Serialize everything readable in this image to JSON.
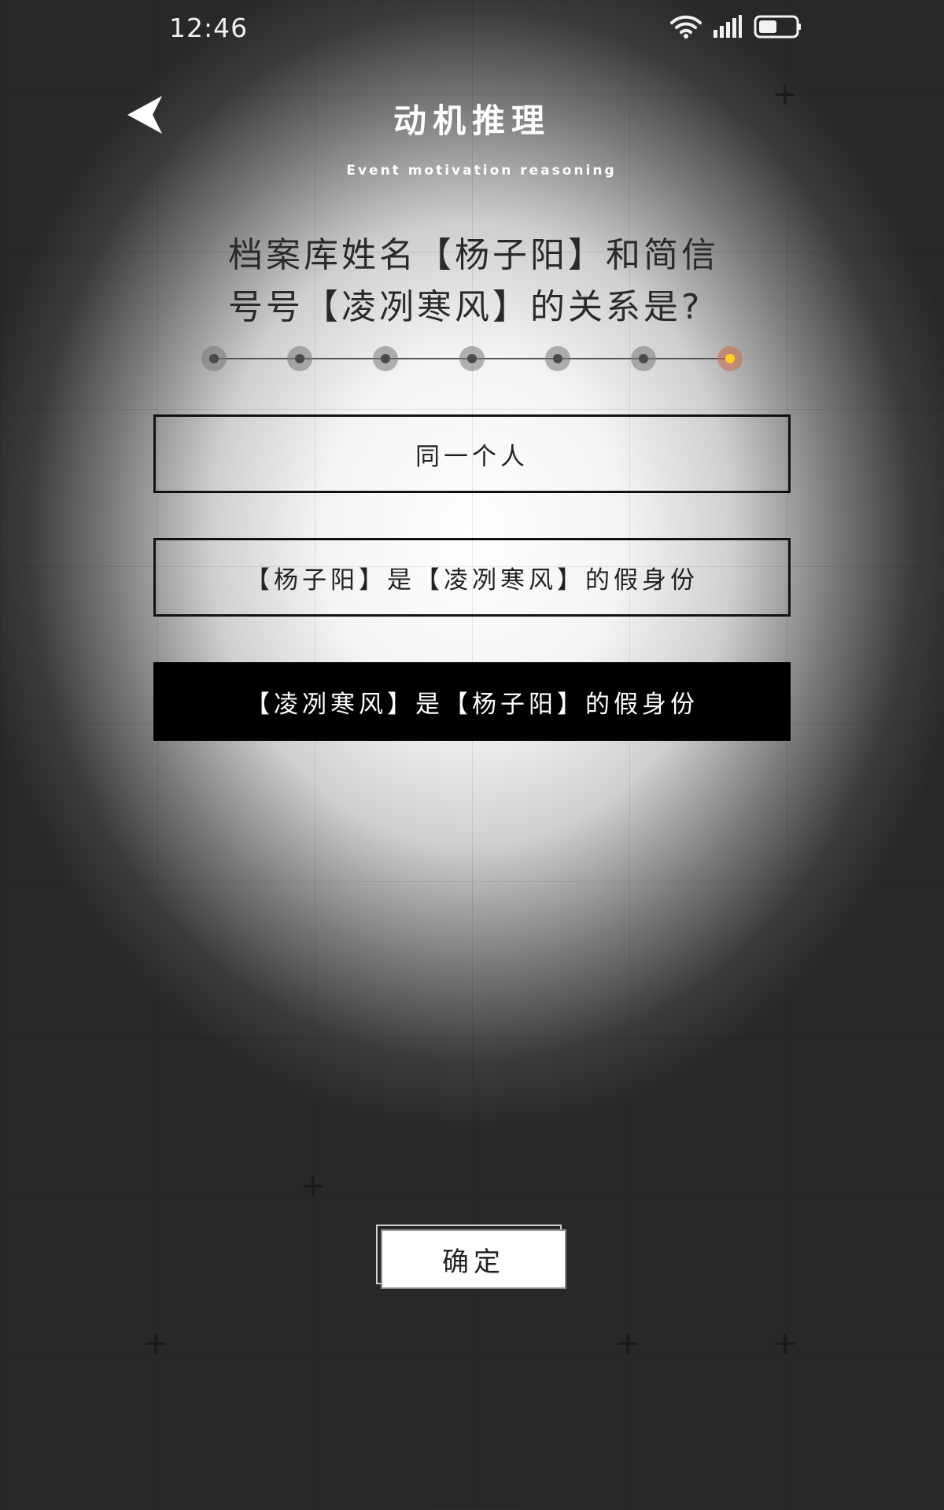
{
  "status_bar": {
    "time": "12:46",
    "icons": [
      "wifi-icon",
      "signal-icon",
      "battery-icon"
    ],
    "battery_level": 0.5
  },
  "header": {
    "back_icon": "back-arrow-icon",
    "title": "动机推理",
    "subtitle": "Event motivation reasoning"
  },
  "question": {
    "text": "档案库姓名【杨子阳】和简信号号【凌冽寒风】的关系是?"
  },
  "progress": {
    "total_steps": 7,
    "current_step": 7,
    "active_color": "#ffd21f"
  },
  "options": [
    {
      "label": "同一个人",
      "selected": false
    },
    {
      "label": "【杨子阳】是【凌冽寒风】的假身份",
      "selected": false
    },
    {
      "label": "【凌冽寒风】是【杨子阳】的假身份",
      "selected": true
    }
  ],
  "confirm": {
    "label": "确定"
  }
}
